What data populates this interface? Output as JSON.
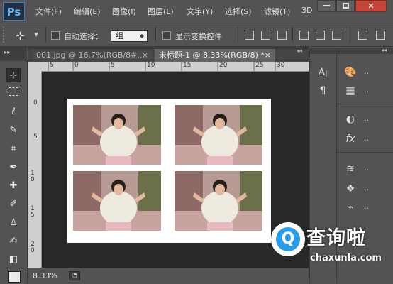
{
  "app": {
    "logo": "Ps"
  },
  "menu": [
    "文件(F)",
    "编辑(E)",
    "图像(I)",
    "图层(L)",
    "文字(Y)",
    "选择(S)",
    "滤镜(T)",
    "3D"
  ],
  "window_controls": {
    "minimize": "—",
    "maximize": "□",
    "close": "✕"
  },
  "options": {
    "auto_select_label": "自动选择：",
    "auto_select_value": "组",
    "show_transform_label": "显示变换控件"
  },
  "tabs": [
    {
      "label": "001.jpg @ 16.7%(RGB/8#...",
      "close": "×",
      "active": false
    },
    {
      "label": "未标题-1 @ 8.33%(RGB/8) *",
      "close": "×",
      "active": true
    }
  ],
  "ruler_top_ticks": [
    "5",
    "0",
    "5",
    "10",
    "15",
    "20",
    "25",
    "30"
  ],
  "ruler_left_ticks": [
    "0",
    "5",
    "1 0",
    "1 5",
    "2 0"
  ],
  "status": {
    "zoom": "8.33%"
  },
  "photos": [
    {
      "name": "photo-top-left"
    },
    {
      "name": "photo-top-right"
    },
    {
      "name": "photo-bottom-left"
    },
    {
      "name": "photo-bottom-right"
    }
  ],
  "watermark": {
    "text": "查询啦",
    "url": "chaxunla.com",
    "icon": "Q"
  },
  "panels": {
    "mid_icons": [
      "character-icon",
      "paragraph-icon"
    ],
    "right_icons": [
      "swatches-icon",
      "table-icon",
      "adjustments-icon",
      "fx-icon",
      "layers-icon",
      "channels-icon",
      "paths-icon"
    ],
    "ellipsis": ".."
  },
  "colors": {
    "accent": "#4a7ab8",
    "canvas_bg": "#282828",
    "ui_bg": "#535353"
  }
}
